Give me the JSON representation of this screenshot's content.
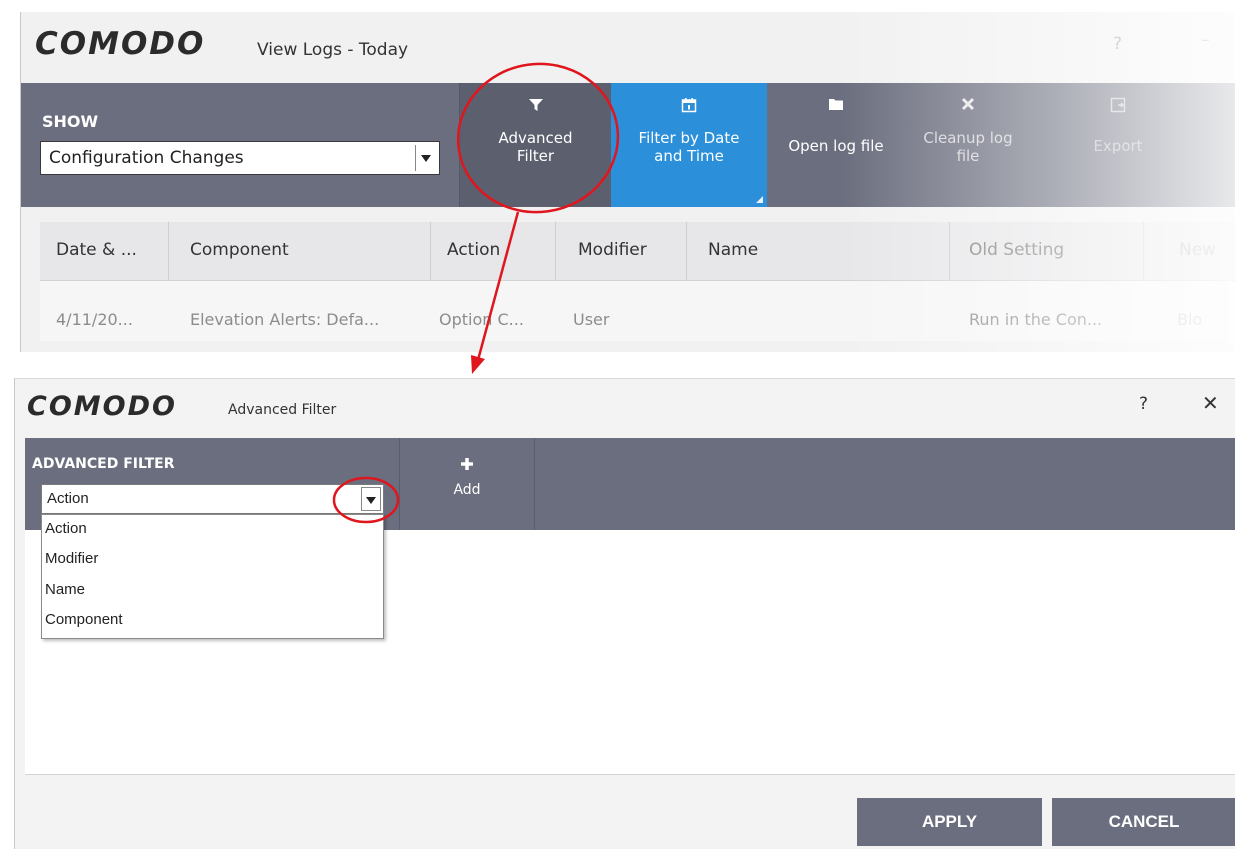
{
  "view_logs": {
    "logo": "COMODO",
    "title": "View Logs - Today",
    "help": "?",
    "minimize": "–",
    "show_label": "SHOW",
    "show_select_value": "Configuration Changes",
    "toolbar": {
      "advanced_filter": {
        "line1": "Advanced",
        "line2": "Filter",
        "icon": "filter-icon"
      },
      "filter_by_date": {
        "line1": "Filter by Date",
        "line2": "and Time",
        "icon": "calendar-icon"
      },
      "open_log": {
        "line1": "Open log file",
        "icon": "folder-icon"
      },
      "cleanup_log": {
        "line1": "Cleanup log",
        "line2": "file",
        "icon": "x-icon"
      },
      "export": {
        "line1": "Export",
        "icon": "export-icon"
      }
    },
    "table": {
      "columns": [
        "Date & ...",
        "Component",
        "Action",
        "Modifier",
        "Name",
        "Old Setting",
        "New"
      ],
      "rows": [
        [
          "4/11/20...",
          "Elevation Alerts: Defa...",
          "Option C...",
          "User",
          "",
          "Run in the Con...",
          "Blo"
        ]
      ]
    }
  },
  "advanced_filter_dialog": {
    "logo": "COMODO",
    "title": "Advanced Filter",
    "help": "?",
    "close": "✕",
    "label": "ADVANCED FILTER",
    "select_value": "Action",
    "add_label": "Add",
    "dropdown_options": [
      "Action",
      "Modifier",
      "Name",
      "Component"
    ],
    "apply_label": "APPLY",
    "cancel_label": "CANCEL"
  },
  "annotation_color": "#e0161e"
}
